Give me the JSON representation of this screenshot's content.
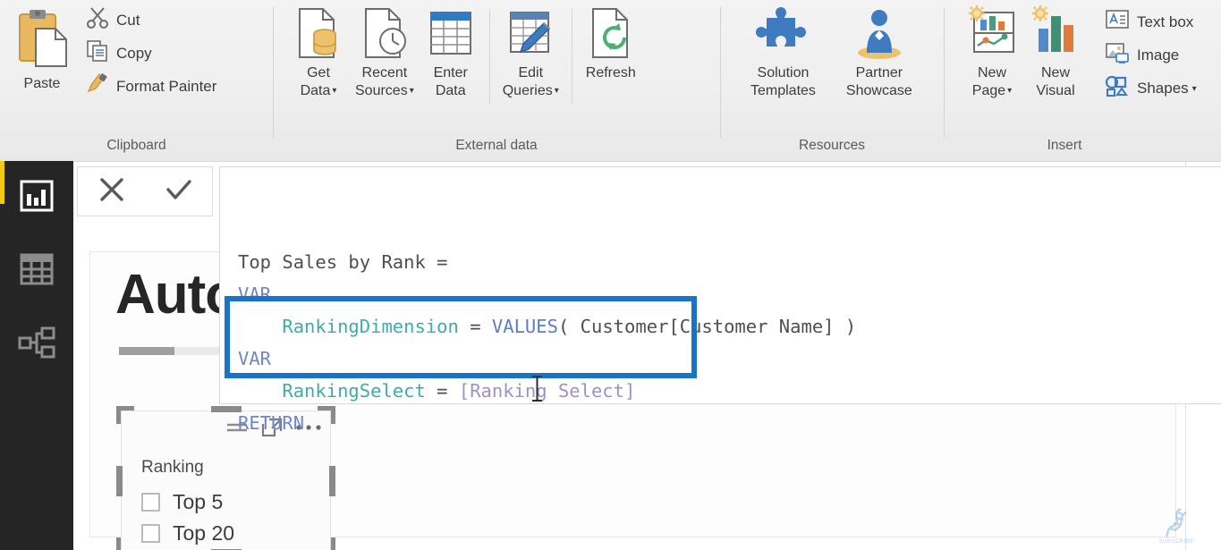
{
  "ribbon": {
    "groups": [
      {
        "name": "Clipboard",
        "label": "Clipboard",
        "big_buttons": [
          {
            "id": "paste",
            "label": "Paste",
            "icon": "paste-icon"
          }
        ],
        "small_buttons": [
          {
            "id": "cut",
            "label": "Cut",
            "icon": "scissors-icon"
          },
          {
            "id": "copy",
            "label": "Copy",
            "icon": "copy-icon"
          },
          {
            "id": "format-painter",
            "label": "Format Painter",
            "icon": "format-painter-icon"
          }
        ]
      },
      {
        "name": "External data",
        "label": "External data",
        "big_buttons": [
          {
            "id": "get-data",
            "label_line1": "Get",
            "label_line2": "Data",
            "icon": "get-data-icon",
            "has_caret": true
          },
          {
            "id": "recent-sources",
            "label_line1": "Recent",
            "label_line2": "Sources",
            "icon": "recent-sources-icon",
            "has_caret": true
          },
          {
            "id": "enter-data",
            "label_line1": "Enter",
            "label_line2": "Data",
            "icon": "enter-data-icon",
            "has_caret": false
          },
          {
            "id": "edit-queries",
            "label_line1": "Edit",
            "label_line2": "Queries",
            "icon": "edit-queries-icon",
            "has_caret": true
          },
          {
            "id": "refresh",
            "label_line1": "Refresh",
            "label_line2": "",
            "icon": "refresh-icon",
            "has_caret": false
          }
        ]
      },
      {
        "name": "Resources",
        "label": "Resources",
        "big_buttons": [
          {
            "id": "solution-templates",
            "label_line1": "Solution",
            "label_line2": "Templates",
            "icon": "puzzle-piece-icon",
            "has_caret": false
          },
          {
            "id": "partner-showcase",
            "label_line1": "Partner",
            "label_line2": "Showcase",
            "icon": "person-icon",
            "has_caret": false
          }
        ]
      },
      {
        "name": "Insert",
        "label": "Insert",
        "big_buttons": [
          {
            "id": "new-page",
            "label_line1": "New",
            "label_line2": "Page",
            "icon": "new-page-icon",
            "has_caret": true
          },
          {
            "id": "new-visual",
            "label_line1": "New",
            "label_line2": "Visual",
            "icon": "new-visual-icon",
            "has_caret": false
          }
        ],
        "small_buttons": [
          {
            "id": "text-box",
            "label": "Text box",
            "icon": "text-box-icon",
            "has_caret": false
          },
          {
            "id": "image",
            "label": "Image",
            "icon": "image-icon",
            "has_caret": false
          },
          {
            "id": "shapes",
            "label": "Shapes",
            "icon": "shapes-icon",
            "has_caret": true
          }
        ]
      }
    ]
  },
  "view_bar": {
    "accent_color": "#f2c811",
    "items": [
      {
        "id": "report-view",
        "icon": "report-bar-chart-icon",
        "active": true
      },
      {
        "id": "data-view",
        "icon": "data-table-icon",
        "active": false
      },
      {
        "id": "model-view",
        "icon": "model-relationships-icon",
        "active": false
      }
    ]
  },
  "formula_toolbar": {
    "cancel": {
      "label": "Cancel",
      "icon": "close-x-icon"
    },
    "commit": {
      "label": "Commit",
      "icon": "checkmark-icon"
    }
  },
  "formula_bar": {
    "measure_name": "Top Sales by Rank",
    "lines": [
      [
        {
          "t": "Top Sales by Rank =",
          "c": "p"
        }
      ],
      [
        {
          "t": "VAR",
          "c": "k"
        }
      ],
      [
        {
          "t": "    ",
          "c": "p"
        },
        {
          "t": "RankingDimension",
          "c": "v"
        },
        {
          "t": " = ",
          "c": "p"
        },
        {
          "t": "VALUES",
          "c": "f"
        },
        {
          "t": "( Customer[Customer Name] )",
          "c": "p"
        }
      ],
      [
        {
          "t": "VAR",
          "c": "k"
        }
      ],
      [
        {
          "t": "    ",
          "c": "p"
        },
        {
          "t": "RankingSelect",
          "c": "v"
        },
        {
          "t": " = ",
          "c": "p"
        },
        {
          "t": "[Ranking Select]",
          "c": "m"
        }
      ],
      [
        {
          "t": "RETURN",
          "c": "k"
        }
      ]
    ],
    "highlight_color": "#1a73c4",
    "highlight_note": "annotation box around RankingSelect variable and RETURN"
  },
  "canvas": {
    "page": {
      "title": "Auto"
    },
    "slicer": {
      "name": "Ranking",
      "title": "Ranking",
      "selected": true,
      "header_icons": [
        {
          "id": "filter",
          "icon": "filter-lines-icon"
        },
        {
          "id": "focus-mode",
          "icon": "focus-mode-icon"
        },
        {
          "id": "more-options",
          "icon": "more-options-ellipsis-icon"
        }
      ],
      "items": [
        {
          "label": "Top 5",
          "checked": false
        },
        {
          "label": "Top 20",
          "checked": false
        }
      ]
    }
  },
  "watermark": {
    "label": "SUBSCRIBE",
    "icon": "dna-helix-icon",
    "color": "#8fb4de"
  }
}
